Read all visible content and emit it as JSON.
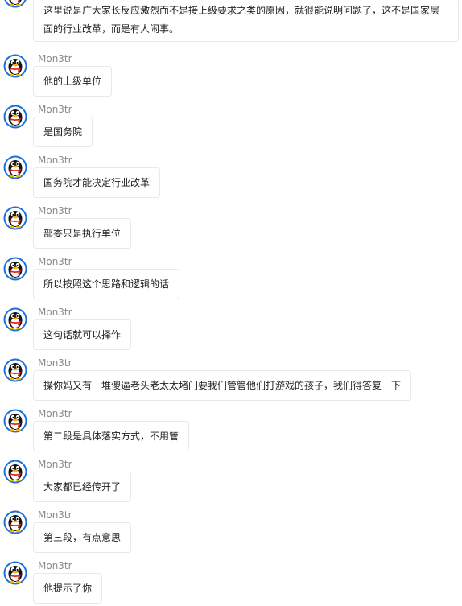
{
  "chat": {
    "sender_name": "Mon3tr",
    "first_message": "这里说是广大家长反应激烈而不是接上级要求之类的原因，就很能说明问题了，这不是国家层面的行业改革，而是有人闹事。",
    "messages": [
      {
        "sender": "Mon3tr",
        "text": "他的上级单位"
      },
      {
        "sender": "Mon3tr",
        "text": "是国务院"
      },
      {
        "sender": "Mon3tr",
        "text": "国务院才能决定行业改革"
      },
      {
        "sender": "Mon3tr",
        "text": "部委只是执行单位"
      },
      {
        "sender": "Mon3tr",
        "text": "所以按照这个思路和逻辑的话"
      },
      {
        "sender": "Mon3tr",
        "text": "这句话就可以择作"
      },
      {
        "sender": "Mon3tr",
        "text": "操你妈又有一堆傻逼老头老太太堵门要我们管管他们打游戏的孩子，我们得答复一下"
      },
      {
        "sender": "Mon3tr",
        "text": "第二段是具体落实方式，不用管"
      },
      {
        "sender": "Mon3tr",
        "text": "大家都已经传开了"
      },
      {
        "sender": "Mon3tr",
        "text": "第三段，有点意思"
      },
      {
        "sender": "Mon3tr",
        "text": "他提示了你"
      }
    ]
  },
  "icons": {
    "avatar": "qq-penguin-avatar-icon"
  },
  "colors": {
    "avatar_ring": "#1a6fe0",
    "bubble_border": "#e9e9e9",
    "sender_text": "#8a8a8a",
    "message_text": "#222222"
  }
}
